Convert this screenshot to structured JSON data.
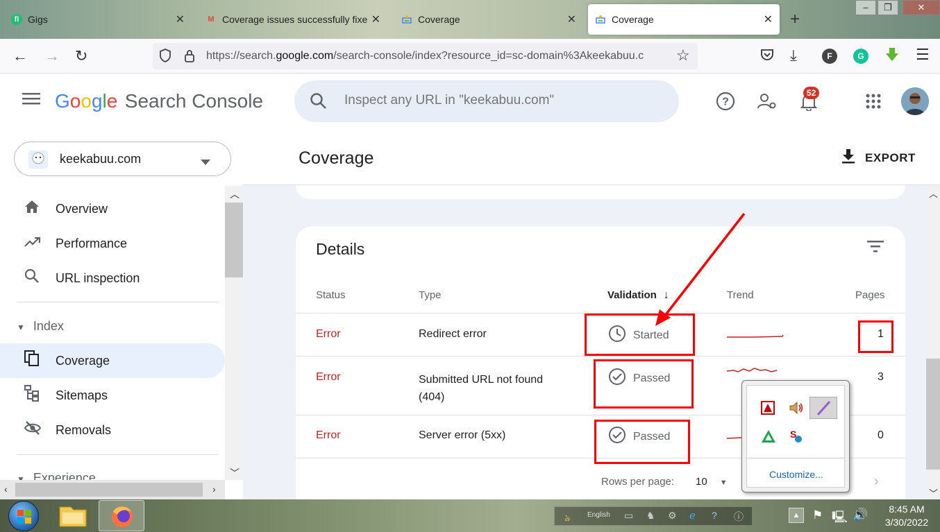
{
  "browser": {
    "tabs": [
      {
        "title": "Gigs",
        "icon": "fi"
      },
      {
        "title": "Coverage issues successfully fixe",
        "icon": "M"
      },
      {
        "title": "Coverage",
        "icon": "gsc"
      },
      {
        "title": "Coverage",
        "icon": "gsc"
      }
    ],
    "close_glyph": "✕",
    "new_tab": "+",
    "url": {
      "prefix": "https://search.",
      "domain": "google.com",
      "rest": "/search-console/index?resource_id=sc-domain%3Akeekabuu.c"
    },
    "ext_f": "F",
    "ext_g": "G"
  },
  "header": {
    "app_title": "Search Console",
    "logo_letters": [
      "G",
      "o",
      "o",
      "g",
      "l",
      "e"
    ],
    "search_placeholder": "Inspect any URL in \"keekabuu.com\"",
    "notification_count": "52"
  },
  "sidebar": {
    "property": "keekabuu.com",
    "items": [
      {
        "label": "Overview",
        "icon": "home-icon"
      },
      {
        "label": "Performance",
        "icon": "trending-icon"
      },
      {
        "label": "URL inspection",
        "icon": "search-icon"
      }
    ],
    "index_section": "Index",
    "index_items": [
      {
        "label": "Coverage",
        "icon": "coverage-icon"
      },
      {
        "label": "Sitemaps",
        "icon": "sitemap-icon"
      },
      {
        "label": "Removals",
        "icon": "removals-icon"
      }
    ],
    "experience_section": "Experience"
  },
  "main": {
    "title": "Coverage",
    "export_label": "EXPORT",
    "details_title": "Details",
    "columns": [
      "Status",
      "Type",
      "Validation",
      "Trend",
      "Pages"
    ],
    "rows": [
      {
        "status": "Error",
        "type": "Redirect error",
        "type2": "",
        "validation": "Started",
        "pages": "1"
      },
      {
        "status": "Error",
        "type": "Submitted URL not found",
        "type2": "(404)",
        "validation": "Passed",
        "pages": "3"
      },
      {
        "status": "Error",
        "type": "Server error (5xx)",
        "type2": "",
        "validation": "Passed",
        "pages": "0"
      }
    ],
    "rows_per_page_label": "Rows per page:",
    "rows_per_page_value": "10"
  },
  "tray_popup": {
    "customize": "Customize..."
  },
  "taskbar": {
    "language": "English",
    "time": "8:45 AM",
    "date": "3/30/2022"
  },
  "colors": {
    "error": "#c5221f",
    "accent_blue": "#1a73e8",
    "annotation_red": "#ff0000"
  }
}
